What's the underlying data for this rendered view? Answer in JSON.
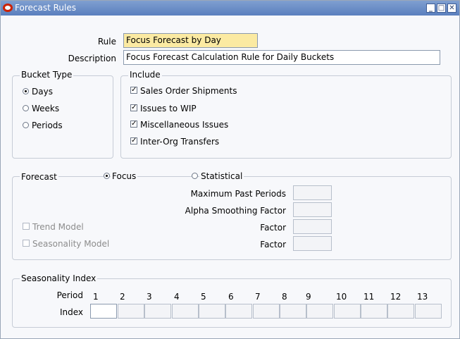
{
  "window": {
    "title": "Forecast Rules"
  },
  "form": {
    "rule_label": "Rule",
    "rule_value": "Focus Forecast by Day",
    "description_label": "Description",
    "description_value": "Focus Forecast Calculation Rule for Daily Buckets"
  },
  "bucket_type": {
    "title": "Bucket Type",
    "options": [
      {
        "label": "Days",
        "selected": true
      },
      {
        "label": "Weeks",
        "selected": false
      },
      {
        "label": "Periods",
        "selected": false
      }
    ]
  },
  "include": {
    "title": "Include",
    "items": [
      {
        "label": "Sales Order Shipments",
        "checked": true
      },
      {
        "label": "Issues to WIP",
        "checked": true
      },
      {
        "label": "Miscellaneous Issues",
        "checked": true
      },
      {
        "label": "Inter-Org Transfers",
        "checked": true
      }
    ]
  },
  "forecast": {
    "title": "Forecast",
    "focus_label": "Focus",
    "focus_selected": true,
    "statistical_label": "Statistical",
    "max_past_periods_label": "Maximum Past Periods",
    "alpha_label": "Alpha Smoothing Factor",
    "trend_model_label": "Trend Model",
    "trend_factor_label": "Factor",
    "seasonality_model_label": "Seasonality Model",
    "seasonality_factor_label": "Factor"
  },
  "seasonality_index": {
    "title": "Seasonality Index",
    "period_label": "Period",
    "index_label": "Index",
    "periods": [
      "1",
      "2",
      "3",
      "4",
      "5",
      "6",
      "7",
      "8",
      "9",
      "10",
      "11",
      "12",
      "13"
    ]
  }
}
